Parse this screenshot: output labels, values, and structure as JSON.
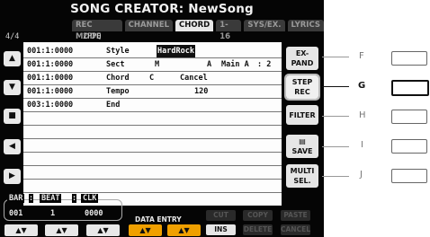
{
  "screen": {
    "title": "SONG CREATOR: NewSong",
    "tabs": [
      {
        "label": "REC MODE",
        "active": false
      },
      {
        "label": "CHANNEL",
        "active": false
      },
      {
        "label": "CHORD",
        "active": true
      },
      {
        "label": "1-16",
        "active": false
      },
      {
        "label": "SYS/EX.",
        "active": false
      },
      {
        "label": "LYRICS",
        "active": false
      }
    ],
    "time_signature": "4/4",
    "resolution": "2PPQ"
  },
  "events": [
    {
      "pos": "001:1:0000",
      "type": "Style",
      "v1": "HardRock",
      "v2": "",
      "v3": "",
      "v4": ""
    },
    {
      "pos": "001:1:0000",
      "type": "Sect",
      "v1": "M",
      "v2": "A",
      "v3": "Main A",
      "v4": ": 2"
    },
    {
      "pos": "001:1:0000",
      "type": "Chord",
      "v1": "C",
      "v2": "Cancel",
      "v3": "",
      "v4": ""
    },
    {
      "pos": "001:1:0000",
      "type": "Tempo",
      "v1": "",
      "v2": "120",
      "v3": "",
      "v4": ""
    },
    {
      "pos": "003:1:0000",
      "type": "End",
      "v1": "",
      "v2": "",
      "v3": "",
      "v4": ""
    }
  ],
  "left_buttons": {
    "a": "▲",
    "b": "▼",
    "c": "■",
    "d": "◀",
    "e": "▶"
  },
  "right_buttons": {
    "expand": [
      "EX-",
      "PAND"
    ],
    "step_rec": [
      "STEP",
      "REC"
    ],
    "filter": [
      "FILTER"
    ],
    "save": [
      "▤",
      "SAVE"
    ],
    "multi_sel": [
      "MULTI",
      "SEL."
    ]
  },
  "side_letters": {
    "f": "F",
    "g": "G",
    "h": "H",
    "i": "I",
    "j": "J"
  },
  "position": {
    "bar_label": "BAR",
    "beat_label": "BEAT",
    "clk_label": "CLK",
    "sep": ":",
    "bar": "001",
    "beat": "1",
    "clk": "0000"
  },
  "data_entry_label": "DATA ENTRY",
  "arrow_label": "▲▼",
  "func_buttons": {
    "cut": "CUT",
    "copy": "COPY",
    "paste": "PASTE",
    "ins": "INS",
    "delete": "DELETE",
    "cancel": "CANCEL"
  },
  "colors": {
    "screen_bg": "#050505",
    "accent_orange": "#f0a000",
    "highlight": "#111111"
  }
}
